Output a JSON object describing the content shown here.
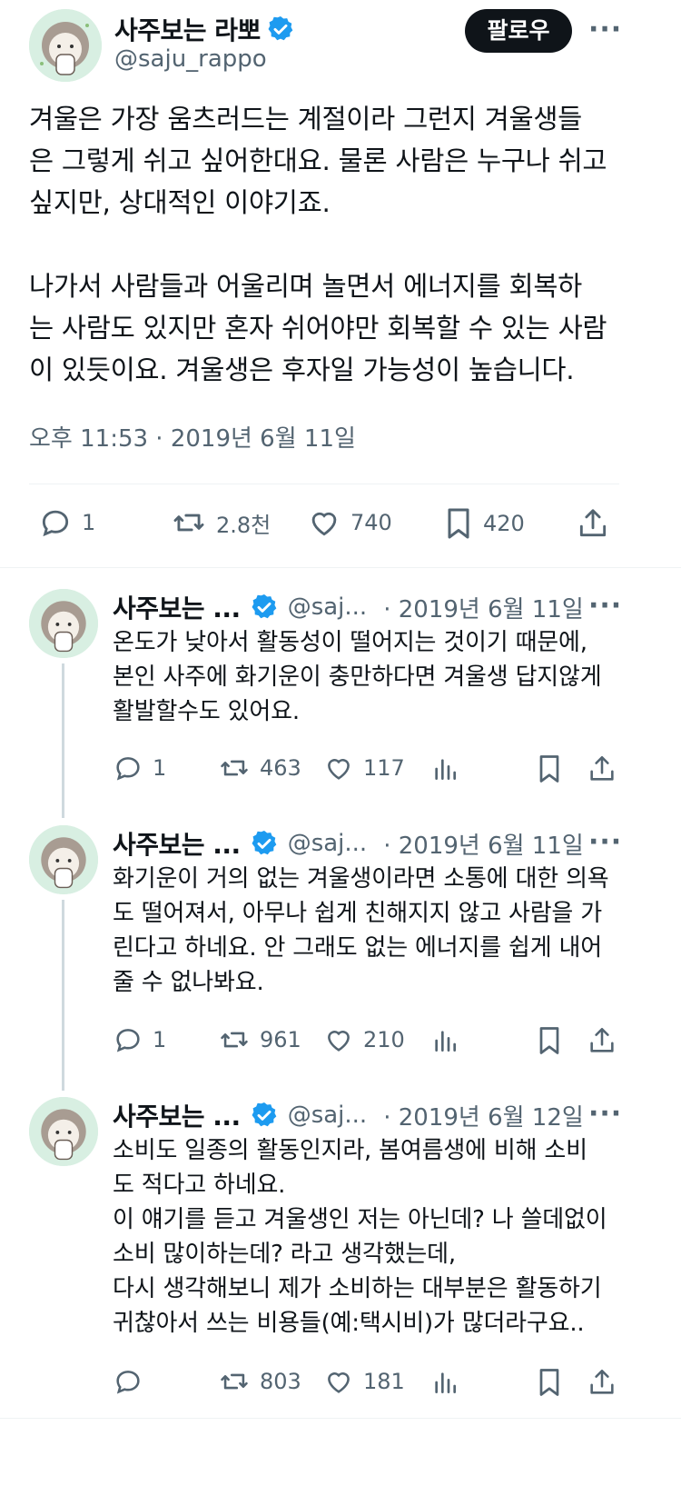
{
  "main_tweet": {
    "author_name": "사주보는 라뽀",
    "handle": "@saju_rappo",
    "follow_label": "팔로우",
    "more_label": "···",
    "text": "겨울은 가장 움츠러드는 계절이라 그런지 겨울생들\n은 그렇게 쉬고 싶어한대요. 물론 사람은 누구나 쉬고\n싶지만, 상대적인 이야기죠.\n\n나가서 사람들과 어울리며 놀면서 에너지를 회복하\n는 사람도 있지만 혼자 쉬어야만 회복할 수 있는 사람\n이 있듯이요. 겨울생은 후자일 가능성이 높습니다.",
    "timestamp": "오후 11:53 · 2019년 6월 11일",
    "stats": {
      "replies": "1",
      "retweets": "2.8천",
      "likes": "740",
      "bookmarks": "420"
    }
  },
  "replies": [
    {
      "author_name": "사주보는 ...",
      "handle": "@saj...",
      "date": "· 2019년 6월 11일",
      "more_label": "···",
      "text": "온도가 낮아서 활동성이 떨어지는 것이기 때문에,\n본인 사주에 화기운이 충만하다면 겨울생 답지않게\n활발할수도 있어요.",
      "replies": "1",
      "retweets": "463",
      "likes": "117"
    },
    {
      "author_name": "사주보는 ...",
      "handle": "@saj...",
      "date": "· 2019년 6월 11일",
      "more_label": "···",
      "text": "화기운이 거의 없는 겨울생이라면 소통에 대한 의욕\n도 떨어져서, 아무나 쉽게 친해지지 않고 사람을 가\n린다고 하네요. 안 그래도 없는 에너지를 쉽게 내어\n줄 수 없나봐요.",
      "replies": "1",
      "retweets": "961",
      "likes": "210"
    },
    {
      "author_name": "사주보는 ...",
      "handle": "@saj...",
      "date": "· 2019년 6월 12일",
      "more_label": "···",
      "text": "소비도 일종의 활동인지라, 봄여름생에 비해 소비\n도 적다고 하네요.\n이 얘기를 듣고 겨울생인 저는 아닌데? 나 쓸데없이\n소비 많이하는데? 라고 생각했는데,\n다시 생각해보니 제가 소비하는 대부분은 활동하기\n귀찮아서 쓰는 비용들(예:택시비)가 많더라구요..",
      "replies": "",
      "retweets": "803",
      "likes": "181"
    }
  ],
  "colors": {
    "text": "#0f1419",
    "secondary": "#536471",
    "verified": "#1d9bf0",
    "divider": "#eff3f4",
    "avatar_bg": "#d8efe2"
  },
  "icons": [
    "leaf-emoji-icon",
    "verified-badge-icon",
    "reply-icon",
    "retweet-icon",
    "like-icon",
    "bookmark-icon",
    "share-icon",
    "views-icon",
    "more-icon"
  ]
}
